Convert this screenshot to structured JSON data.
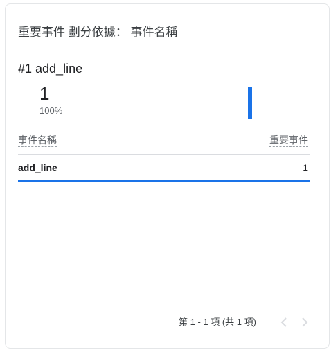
{
  "card": {
    "title_metric": "重要事件",
    "title_connector": " 劃分依據： ",
    "title_dimension": "事件名稱"
  },
  "top_item": {
    "rank_label": "#1 add_line",
    "value": "1",
    "percent": "100%",
    "spark_fraction": 1.0
  },
  "table": {
    "col_dimension": "事件名稱",
    "col_metric": "重要事件",
    "rows": [
      {
        "name": "add_line",
        "value": "1"
      }
    ]
  },
  "pagination": {
    "text": "第 1 - 1 項 (共 1 項)",
    "prev_icon": "chevron-left-icon",
    "next_icon": "chevron-right-icon"
  },
  "colors": {
    "accent": "#1a73e8",
    "disabled": "#dadce0"
  }
}
